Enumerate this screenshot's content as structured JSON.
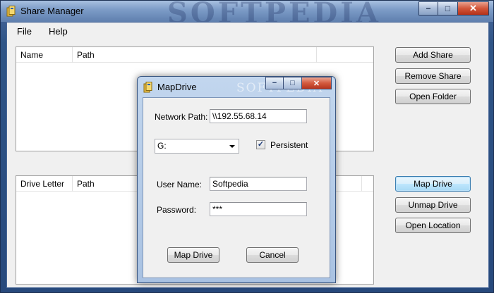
{
  "main": {
    "title": "Share Manager",
    "watermark": "SOFTPEDIA",
    "menu": [
      "File",
      "Help"
    ],
    "shares_list": {
      "columns": [
        "Name",
        "Path"
      ]
    },
    "drives_list": {
      "columns": [
        "Drive Letter",
        "Path"
      ]
    },
    "buttons": {
      "add_share": "Add Share",
      "remove_share": "Remove Share",
      "open_folder": "Open Folder",
      "map_drive": "Map Drive",
      "unmap_drive": "Unmap Drive",
      "open_location": "Open Location"
    },
    "controls": {
      "minimize": "−",
      "maximize": "□",
      "close": "✕"
    }
  },
  "dialog": {
    "title": "MapDrive",
    "watermark": "SOFTPEDIA",
    "network_path_label": "Network Path:",
    "network_path_value": "\\\\192.55.68.14",
    "drive_letter_value": "G:",
    "persistent_label": "Persistent",
    "persistent_checked": true,
    "username_label": "User Name:",
    "username_value": "Softpedia",
    "password_label": "Password:",
    "password_value": "***",
    "map_button": "Map Drive",
    "cancel_button": "Cancel",
    "controls": {
      "minimize": "−",
      "maximize": "□",
      "close": "✕"
    }
  },
  "colors": {
    "title_bar": "#7e9dc8",
    "close_button": "#d2563a",
    "focus_border": "#3c7fb1"
  }
}
